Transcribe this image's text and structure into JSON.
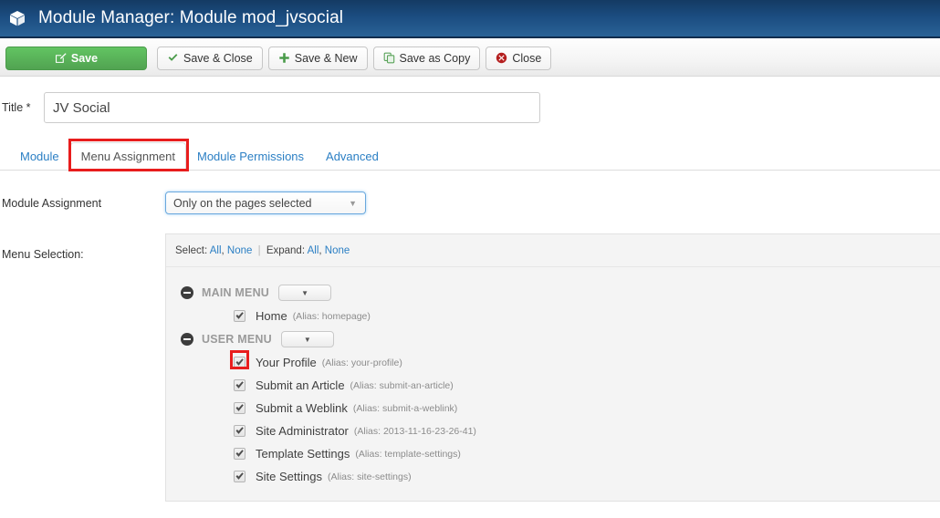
{
  "titlebar": {
    "icon": "module-cube-icon",
    "title": "Module Manager: Module mod_jvsocial"
  },
  "toolbar": {
    "buttons": [
      {
        "label": "Save",
        "icon": "pencil-square-icon"
      },
      {
        "label": "Save & Close",
        "icon": "check-icon"
      },
      {
        "label": "Save & New",
        "icon": "plus-icon"
      },
      {
        "label": "Save as Copy",
        "icon": "copy-icon"
      },
      {
        "label": "Close",
        "icon": "close-circle-icon"
      }
    ]
  },
  "form": {
    "title_label": "Title *",
    "title_value": "JV Social",
    "assignment_label": "Module Assignment",
    "assignment_value": "Only on the pages selected",
    "menu_selection_label": "Menu Selection:"
  },
  "tabs": [
    {
      "label": "Module",
      "active": false
    },
    {
      "label": "Menu Assignment",
      "active": true
    },
    {
      "label": "Module Permissions",
      "active": false
    },
    {
      "label": "Advanced",
      "active": false
    }
  ],
  "panel": {
    "head": {
      "select_text": "Select:",
      "select_all": "All",
      "comma": ",",
      "select_none": "None",
      "separator": "|",
      "expand_text": "Expand:",
      "expand_all": "All",
      "expand_none": "None"
    },
    "groups": [
      {
        "name": "MAIN MENU",
        "items": [
          {
            "name": "Home",
            "alias": "(Alias: homepage)",
            "checked": true
          }
        ]
      },
      {
        "name": "USER MENU",
        "items": [
          {
            "name": "Your Profile",
            "alias": "(Alias: your-profile)",
            "checked": true
          },
          {
            "name": "Submit an Article",
            "alias": "(Alias: submit-an-article)",
            "checked": true
          },
          {
            "name": "Submit a Weblink",
            "alias": "(Alias: submit-a-weblink)",
            "checked": true
          },
          {
            "name": "Site Administrator",
            "alias": "(Alias: 2013-11-16-23-26-41)",
            "checked": true
          },
          {
            "name": "Template Settings",
            "alias": "(Alias: template-settings)",
            "checked": true
          },
          {
            "name": "Site Settings",
            "alias": "(Alias: site-settings)",
            "checked": true
          }
        ]
      }
    ]
  },
  "colors": {
    "titlebar_blue": "#1b4c80",
    "save_green": "#51a351",
    "link_blue": "#2b7fc4",
    "annotation_red": "#e81d1d",
    "close_red": "#b52020"
  }
}
